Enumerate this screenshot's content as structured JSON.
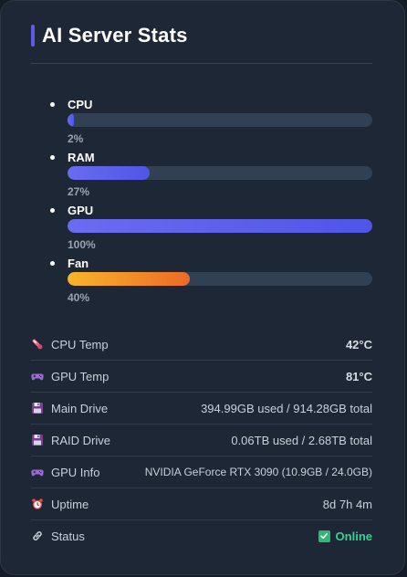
{
  "header": {
    "title": "AI Server Stats"
  },
  "bars": [
    {
      "label": "CPU",
      "value_text": "2%",
      "fraction": 0.02,
      "color": "blue"
    },
    {
      "label": "RAM",
      "value_text": "27%",
      "fraction": 0.27,
      "color": "blue"
    },
    {
      "label": "GPU",
      "value_text": "100%",
      "fraction": 1.0,
      "color": "blue"
    },
    {
      "label": "Fan",
      "value_text": "40%",
      "fraction": 0.4,
      "color": "orange"
    }
  ],
  "stats": {
    "cpu_temp": {
      "label": "CPU Temp",
      "value": "42°C",
      "icon": "thermometer-icon"
    },
    "gpu_temp": {
      "label": "GPU Temp",
      "value": "81°C",
      "icon": "gamepad-icon"
    },
    "main_drive": {
      "label": "Main Drive",
      "value": "394.99GB used / 914.28GB total",
      "icon": "floppy-disk-icon"
    },
    "raid_drive": {
      "label": "RAID Drive",
      "value": "0.06TB used / 2.68TB total",
      "icon": "floppy-disk-icon"
    },
    "gpu_info": {
      "label": "GPU Info",
      "value": "NVIDIA GeForce RTX 3090 (10.9GB / 24.0GB)",
      "icon": "gamepad-icon"
    },
    "uptime": {
      "label": "Uptime",
      "value": "8d 7h 4m",
      "icon": "alarm-clock-icon"
    },
    "status": {
      "label": "Status",
      "value": "Online",
      "icon": "link-icon"
    }
  },
  "colors": {
    "accent": "#5c5ce6",
    "bar_blue": "#5b5fec",
    "bar_orange_start": "#f7b52a",
    "bar_orange_end": "#ec6a27",
    "online": "#2fd68f"
  }
}
